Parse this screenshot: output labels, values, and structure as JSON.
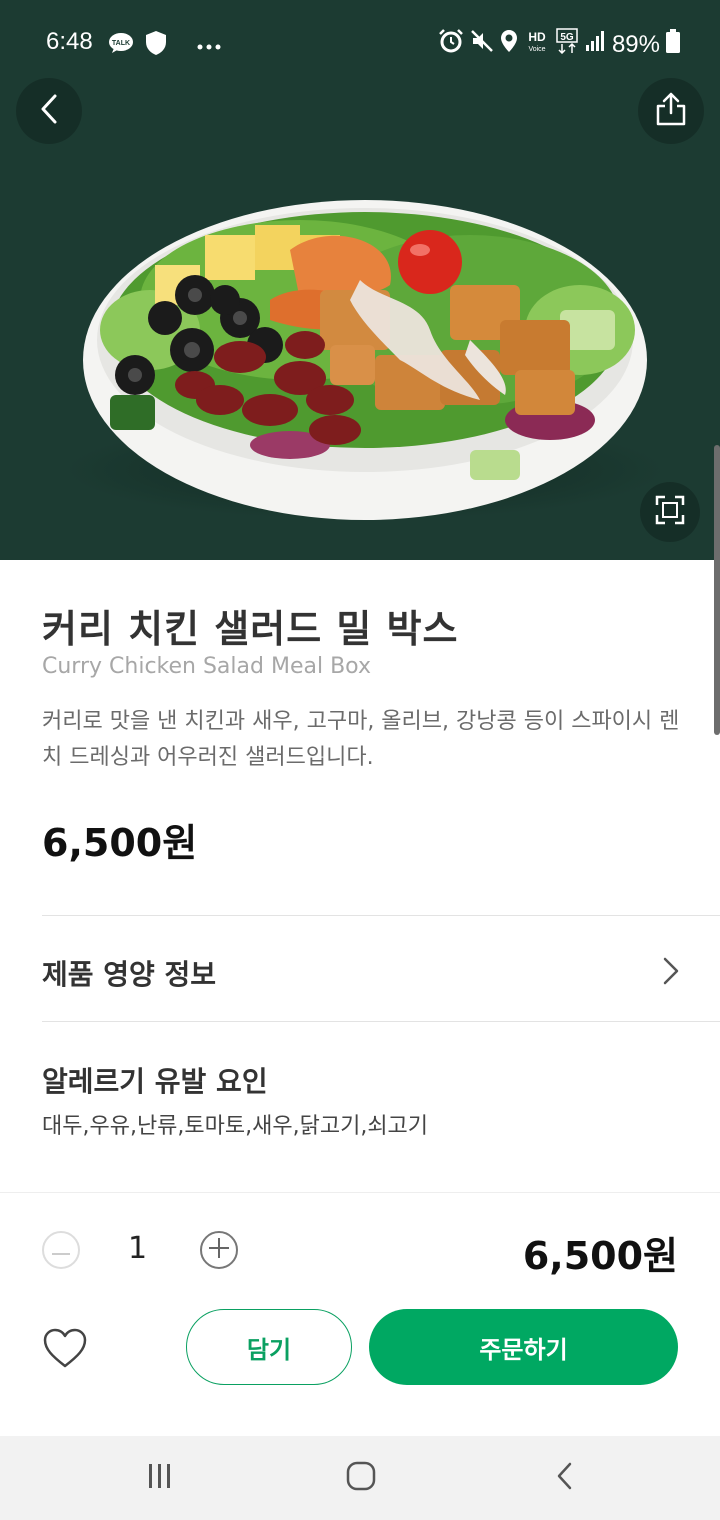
{
  "status_bar": {
    "time": "6:48",
    "battery": "89%",
    "icons": [
      "talk-icon",
      "shield-icon",
      "more-dots-icon",
      "alarm-icon",
      "mute-icon",
      "location-icon",
      "hd-voice-icon",
      "5g-icon",
      "signal-icon",
      "battery-icon"
    ]
  },
  "hero": {
    "background_color": "#1c3b32",
    "image_alt": "salad-bowl"
  },
  "product": {
    "title_ko": "커리 치킨 샐러드 밀 박스",
    "title_en": "Curry Chicken Salad Meal Box",
    "description": "커리로 맛을 낸 치킨과 새우, 고구마, 올리브, 강낭콩 등이 스파이시 렌치 드레싱과 어우러진 샐러드입니다.",
    "price": "6,500원"
  },
  "nutrition": {
    "label": "제품 영양 정보"
  },
  "allergy": {
    "title": "알레르기 유발 요인",
    "items": "대두,우유,난류,토마토,새우,닭고기,쇠고기"
  },
  "order": {
    "quantity": "1",
    "total_price": "6,500원",
    "cart_label": "담기",
    "order_label": "주문하기"
  },
  "colors": {
    "accent": "#00a862",
    "hero_bg": "#1c3b32"
  }
}
